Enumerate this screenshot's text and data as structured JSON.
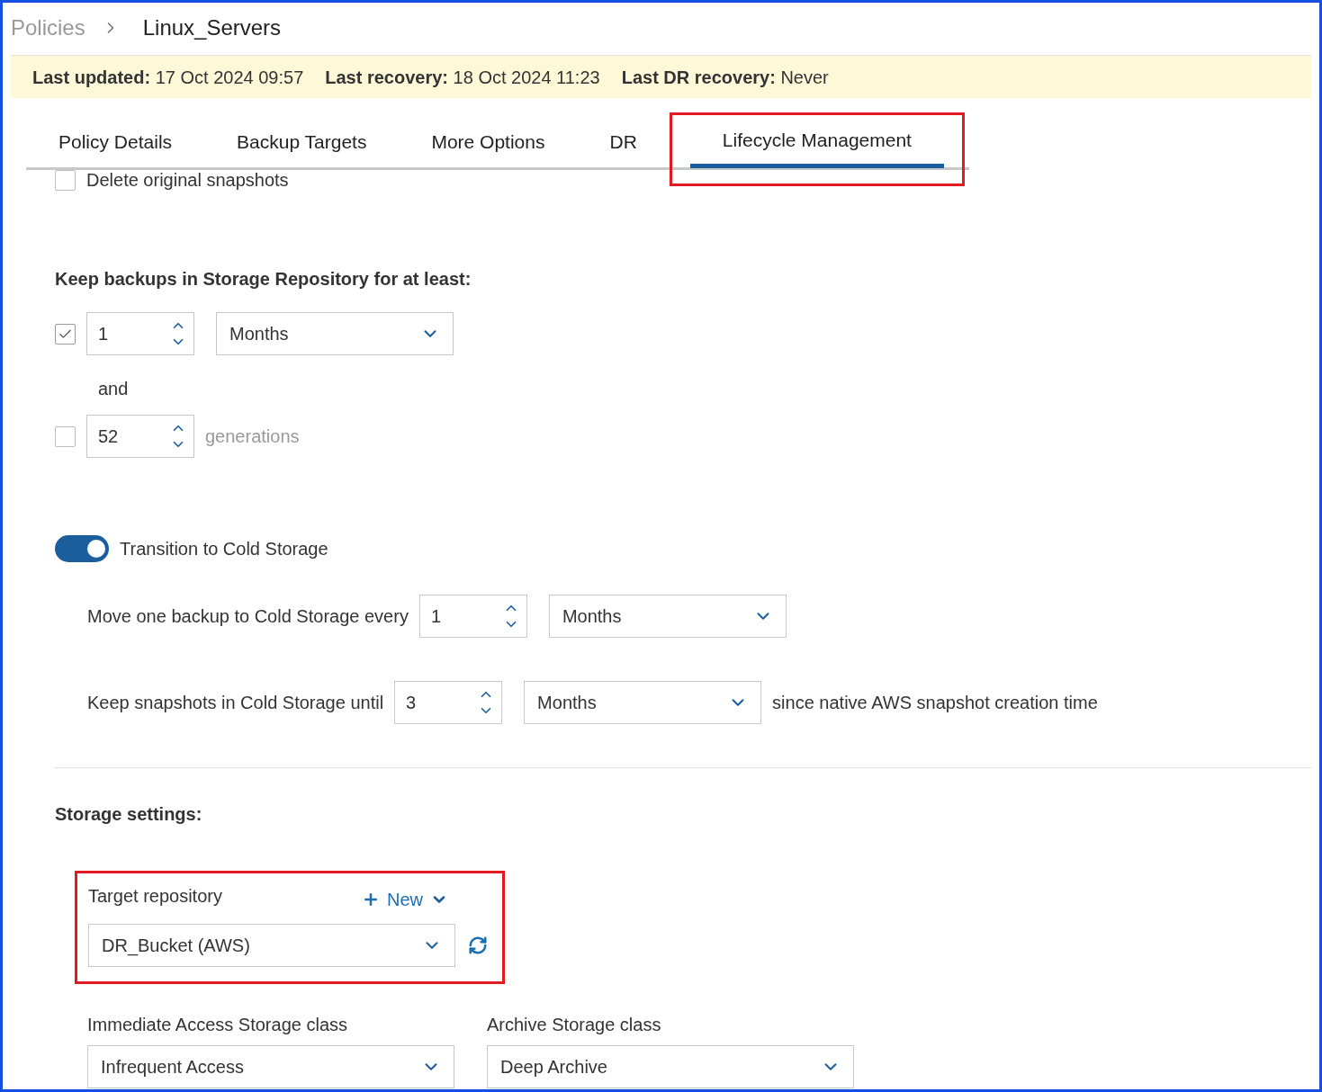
{
  "breadcrumb": [
    {
      "label": "Policies"
    },
    {
      "label": "Linux_Servers"
    }
  ],
  "status_bar": [
    "**Last updated:** 17 Oct 2024 09:57",
    "**Last recovery:** 18 Oct 2024 11:23",
    "**Last DR recovery:** Never"
  ],
  "tabs": [
    {
      "label": "Policy Details",
      "selected": false,
      "highlighted": false
    },
    {
      "label": "Backup Targets",
      "selected": false,
      "highlighted": false
    },
    {
      "label": "More Options",
      "selected": false,
      "highlighted": false
    },
    {
      "label": "DR",
      "selected": false,
      "highlighted": false
    },
    {
      "label": "Lifecycle Management",
      "selected": true,
      "highlighted": true
    }
  ],
  "delete_original_snapshots": {
    "label": "Delete original snapshots",
    "checked": false
  },
  "retention": {
    "heading": "Keep backups in Storage Repository for at least:",
    "period": {
      "checked": true,
      "value": "1",
      "unit": "Months"
    },
    "joiner": "and",
    "generations": {
      "checked": false,
      "value": "52",
      "label": "generations"
    }
  },
  "cold_storage": {
    "label": "Transition to Cold Storage",
    "on": true,
    "move_every": {
      "label": "Move one backup to Cold Storage every",
      "value": "1",
      "unit": "Months"
    },
    "keep_until": {
      "label": "Keep snapshots in Cold Storage until",
      "value": "3",
      "unit": "Months",
      "suffix": "since native AWS snapshot creation time"
    }
  },
  "storage_settings": {
    "heading": "Storage settings:",
    "target_repository": {
      "label": "Target repository",
      "new_button": "New",
      "value": "DR_Bucket (AWS)",
      "highlighted": true
    },
    "classes": [
      {
        "label": "Immediate Access Storage class",
        "value": "Infrequent Access"
      },
      {
        "label": "Archive Storage class",
        "value": "Deep Archive"
      }
    ]
  }
}
